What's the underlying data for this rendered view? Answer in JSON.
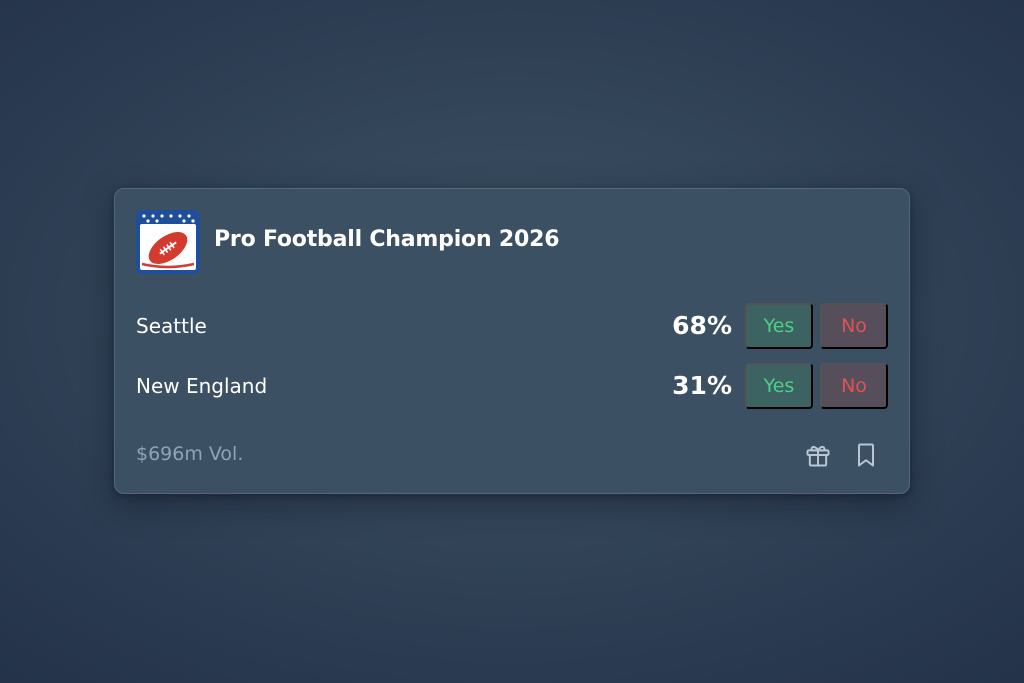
{
  "market": {
    "title": "Pro Football Champion 2026",
    "logo_icon": "football-shield-icon",
    "outcomes": [
      {
        "team": "Seattle",
        "probability": "68%",
        "yes_label": "Yes",
        "no_label": "No"
      },
      {
        "team": "New England",
        "probability": "31%",
        "yes_label": "Yes",
        "no_label": "No"
      }
    ],
    "volume": "$696m Vol.",
    "actions": {
      "gift_icon": "gift-icon",
      "bookmark_icon": "bookmark-icon"
    }
  },
  "colors": {
    "card_background": "#3c5064",
    "yes_text": "#4fce88",
    "yes_background": "#3c6362",
    "no_text": "#e05252",
    "no_background": "#574e5c",
    "logo_blue": "#1f4f9a",
    "logo_red": "#d43b2f"
  }
}
